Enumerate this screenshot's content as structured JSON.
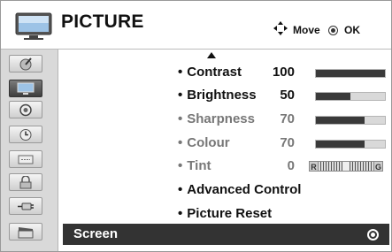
{
  "header": {
    "title": "PICTURE",
    "hint_move": "Move",
    "hint_ok": "OK",
    "icon": "tv-icon"
  },
  "sidebar": {
    "items": [
      {
        "icon": "antenna-setup-icon",
        "active": false
      },
      {
        "icon": "picture-tv-icon",
        "active": true
      },
      {
        "icon": "audio-speaker-icon",
        "active": false
      },
      {
        "icon": "time-clock-icon",
        "active": false
      },
      {
        "icon": "option-icon",
        "active": false
      },
      {
        "icon": "lock-icon",
        "active": false
      },
      {
        "icon": "input-cable-icon",
        "active": false
      },
      {
        "icon": "media-clapper-icon",
        "active": false
      }
    ]
  },
  "menu": {
    "items": [
      {
        "label": "Contrast",
        "value": "100",
        "level": 1.0,
        "enabled": true
      },
      {
        "label": "Brightness",
        "value": "50",
        "level": 0.5,
        "enabled": true
      },
      {
        "label": "Sharpness",
        "value": "70",
        "level": 0.7,
        "enabled": false
      },
      {
        "label": "Colour",
        "value": "70",
        "level": 0.7,
        "enabled": false
      },
      {
        "label": "Tint",
        "value": "0",
        "enabled": false
      },
      {
        "label": "Advanced Control",
        "enabled": true
      },
      {
        "label": "Picture Reset",
        "enabled": true
      }
    ],
    "tint_left": "R",
    "tint_right": "G",
    "selected": {
      "label": "Screen"
    }
  },
  "colors": {
    "sidebar_bg": "#d9d9d9",
    "selected_bg": "#333333",
    "bar_fill": "#3a3a3a",
    "disabled_text": "#777777"
  }
}
